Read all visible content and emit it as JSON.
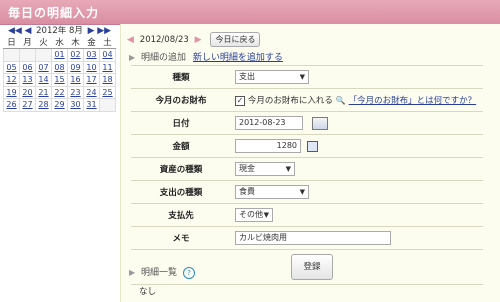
{
  "header": {
    "title": "毎日の明細入力"
  },
  "calendar": {
    "prev_year": "◀◀",
    "prev_month": "◀",
    "year_month": "2012年 8月",
    "next_month": "▶",
    "next_year": "▶▶",
    "weekdays": [
      "日",
      "月",
      "火",
      "水",
      "木",
      "金",
      "土"
    ],
    "weeks": [
      [
        "",
        "",
        "",
        "01",
        "02",
        "03",
        "04"
      ],
      [
        "05",
        "06",
        "07",
        "08",
        "09",
        "10",
        "11"
      ],
      [
        "12",
        "13",
        "14",
        "15",
        "16",
        "17",
        "18"
      ],
      [
        "19",
        "20",
        "21",
        "22",
        "23",
        "24",
        "25"
      ],
      [
        "26",
        "27",
        "28",
        "29",
        "30",
        "31",
        ""
      ]
    ]
  },
  "datebar": {
    "prev": "◀",
    "date": "2012/08/23",
    "next": "▶",
    "today_button": "今日に戻る"
  },
  "add_section": {
    "label": "明細の追加",
    "link": "新しい明細を追加する"
  },
  "form": {
    "type_label": "種類",
    "type_value": "支出",
    "wallet_label": "今月のお財布",
    "wallet_checkbox_label": "今月のお財布に入れる",
    "wallet_help": "「今月のお財布」とは何ですか？",
    "date_label": "日付",
    "date_value": "2012-08-23",
    "amount_label": "金額",
    "amount_value": "1280",
    "asset_label": "資産の種類",
    "asset_value": "現金",
    "expense_label": "支出の種類",
    "expense_value": "食費",
    "payee_label": "支払先",
    "payee_value": "その他",
    "memo_label": "メモ",
    "memo_value": "カルビ焼肉用",
    "submit_label": "登録"
  },
  "list_section": {
    "label": "明細一覧",
    "help": "?",
    "empty": "なし"
  }
}
